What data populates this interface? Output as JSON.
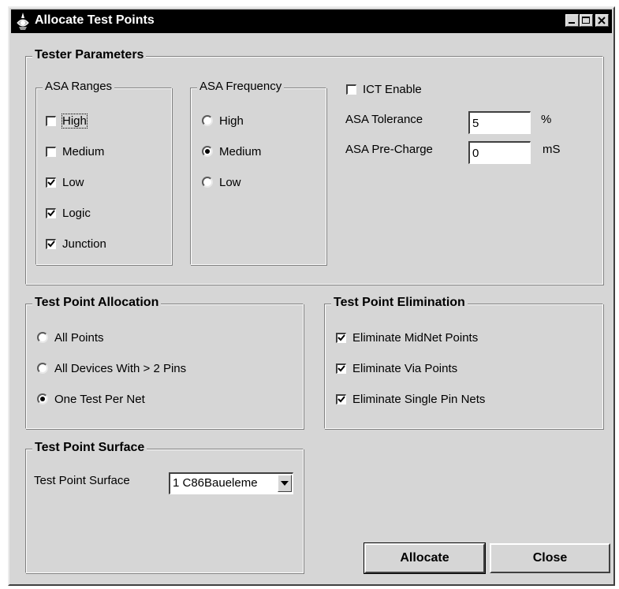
{
  "window": {
    "title": "Allocate Test Points"
  },
  "tester_parameters": {
    "legend": "Tester Parameters",
    "asa_ranges": {
      "legend": "ASA Ranges",
      "items": [
        {
          "label": "High",
          "checked": false
        },
        {
          "label": "Medium",
          "checked": false
        },
        {
          "label": "Low",
          "checked": true
        },
        {
          "label": "Logic",
          "checked": true
        },
        {
          "label": "Junction",
          "checked": true
        }
      ]
    },
    "asa_frequency": {
      "legend": "ASA Frequency",
      "items": [
        {
          "label": "High",
          "selected": false
        },
        {
          "label": "Medium",
          "selected": true
        },
        {
          "label": "Low",
          "selected": false
        }
      ]
    },
    "ict_enable": {
      "label": "ICT Enable",
      "checked": false
    },
    "asa_tolerance": {
      "label": "ASA Tolerance",
      "value": "5",
      "unit": "%"
    },
    "asa_precharge": {
      "label": "ASA Pre-Charge",
      "value": "0",
      "unit": "mS"
    }
  },
  "allocation": {
    "legend": "Test Point Allocation",
    "items": [
      {
        "label": "All Points",
        "selected": false
      },
      {
        "label": "All Devices With > 2 Pins",
        "selected": false
      },
      {
        "label": "One Test Per Net",
        "selected": true
      }
    ]
  },
  "elimination": {
    "legend": "Test Point Elimination",
    "items": [
      {
        "label": "Eliminate MidNet Points",
        "checked": true
      },
      {
        "label": "Eliminate Via Points",
        "checked": true
      },
      {
        "label": "Eliminate Single Pin Nets",
        "checked": true
      }
    ]
  },
  "surface": {
    "legend": "Test Point Surface",
    "label": "Test Point Surface",
    "selected": "1 C86Baueleme"
  },
  "buttons": {
    "allocate": "Allocate",
    "close": "Close"
  }
}
